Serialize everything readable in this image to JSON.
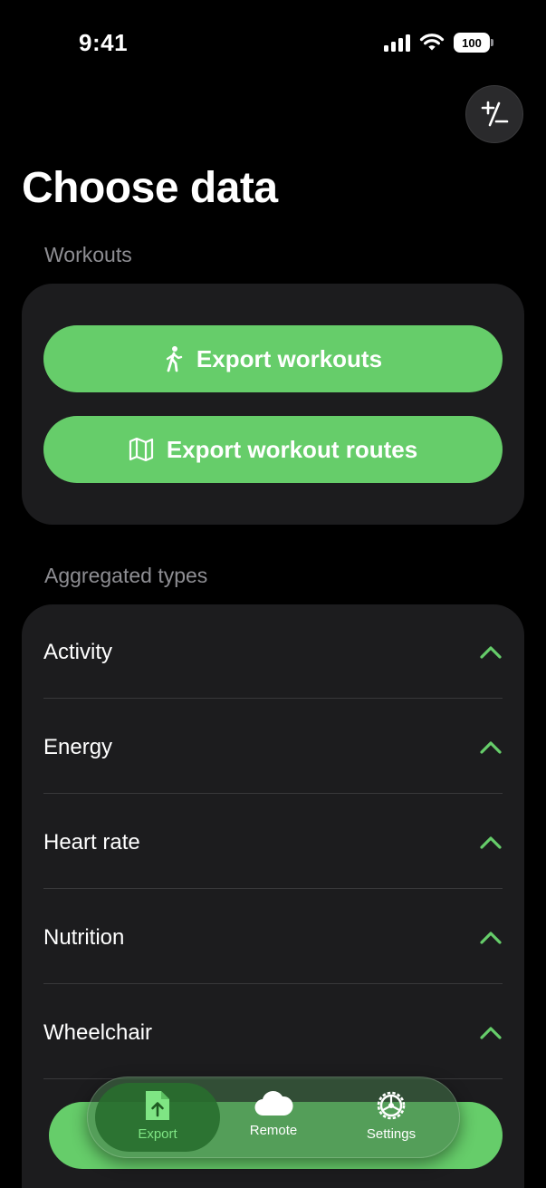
{
  "status": {
    "time": "9:41",
    "battery": "100"
  },
  "title": "Choose data",
  "sections": {
    "workouts": {
      "label": "Workouts",
      "buttons": [
        {
          "label": "Export workouts",
          "icon": "figure-walk-icon"
        },
        {
          "label": "Export workout routes",
          "icon": "map-icon"
        }
      ]
    },
    "aggregated": {
      "label": "Aggregated types",
      "items": [
        {
          "label": "Activity"
        },
        {
          "label": "Energy"
        },
        {
          "label": "Heart rate"
        },
        {
          "label": "Nutrition"
        },
        {
          "label": "Wheelchair"
        }
      ]
    }
  },
  "tabs": [
    {
      "label": "Export",
      "icon": "export-doc-icon",
      "active": true
    },
    {
      "label": "Remote",
      "icon": "cloud-icon",
      "active": false
    },
    {
      "label": "Settings",
      "icon": "gear-icon",
      "active": false
    }
  ],
  "colors": {
    "accent": "#66cd6a",
    "card": "#1c1c1e",
    "background": "#000000",
    "secondary_text": "#8e8e93"
  }
}
